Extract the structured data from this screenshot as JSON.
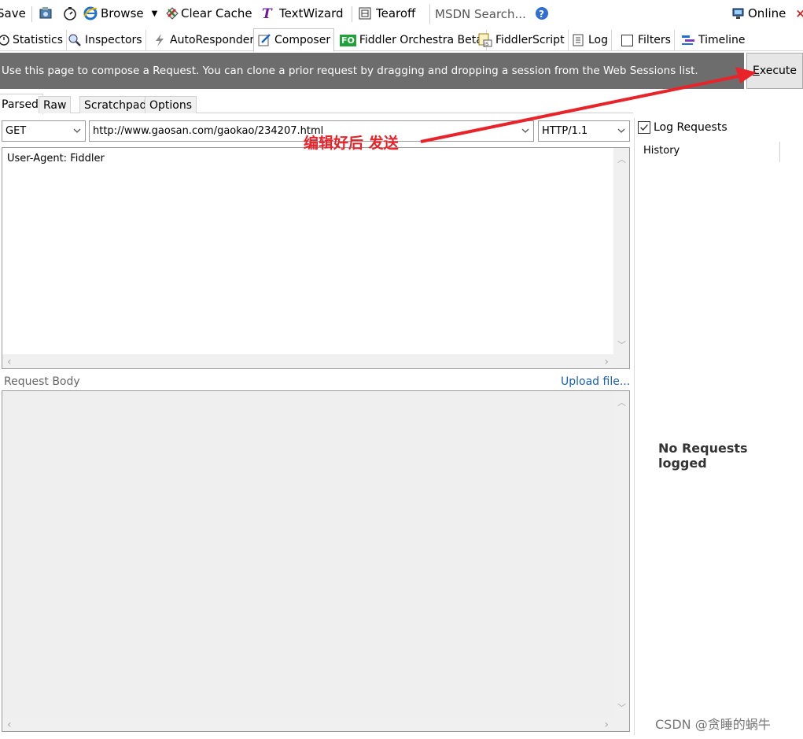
{
  "toolbar": {
    "save": "Save",
    "browse": "Browse",
    "clear_cache": "Clear Cache",
    "text_wizard": "TextWizard",
    "tearoff": "Tearoff",
    "search_placeholder": "MSDN Search...",
    "online": "Online"
  },
  "tabs": {
    "statistics": "Statistics",
    "inspectors": "Inspectors",
    "autoresponder": "AutoResponder",
    "composer": "Composer",
    "orchestra": "Fiddler Orchestra Beta",
    "script": "FiddlerScript",
    "log": "Log",
    "filters": "Filters",
    "timeline": "Timeline",
    "orchestra_badge": "FO"
  },
  "infobar": {
    "text": "Use this page to compose a Request. You can clone a prior request by dragging and dropping a session from the Web Sessions list.",
    "execute_prefix": "",
    "execute_accel": "E",
    "execute_rest": "xecute"
  },
  "subtabs": {
    "parsed": "Parsed",
    "raw": "Raw",
    "scratchpad": "Scratchpad",
    "options": "Options"
  },
  "request": {
    "method": "GET",
    "url": "http://www.gaosan.com/gaokao/234207.html",
    "version": "HTTP/1.1",
    "headers": "User-Agent: Fiddler",
    "body_label": "Request Body",
    "upload": "Upload file..."
  },
  "right_pane": {
    "log_requests": "Log Requests",
    "history": "History",
    "empty": "No Requests logged"
  },
  "annotation": {
    "text": "编辑好后 发送",
    "color": "#e8232a"
  },
  "watermark": "CSDN @贪睡的蜗牛"
}
